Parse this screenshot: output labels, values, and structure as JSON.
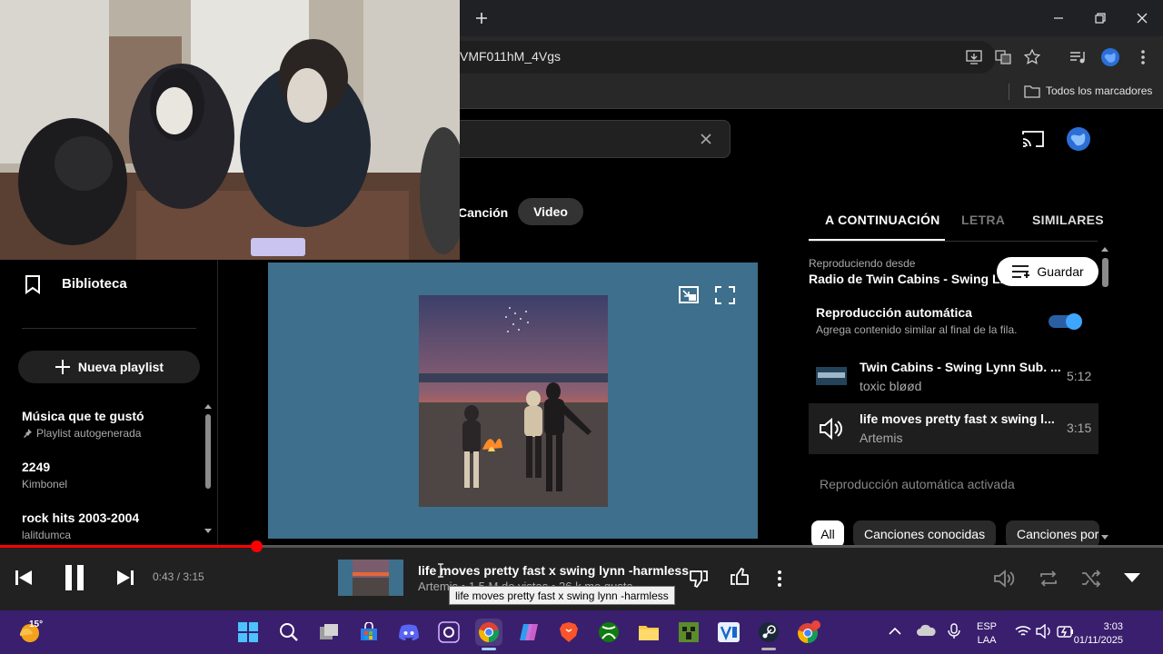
{
  "browser": {
    "url_fragment": "VMF011hM_4Vgs",
    "bookmarks_label": "Todos los marcadores"
  },
  "nav": {
    "library_label": "Biblioteca",
    "new_playlist_label": "Nueva playlist",
    "playlists": [
      {
        "title": "Música que te gustó",
        "subtitle": "Playlist autogenerada",
        "pinned": true
      },
      {
        "title": "2249",
        "subtitle": "Kimbonel"
      },
      {
        "title": "rock hits 2003-2004",
        "subtitle": "lalitdumca"
      }
    ]
  },
  "toggle": {
    "song_label": "Canción",
    "video_label": "Video",
    "active": "Video"
  },
  "queue_panel": {
    "tabs": [
      "A CONTINUACIÓN",
      "LETRA",
      "SIMILARES"
    ],
    "active_tab": "A CONTINUACIÓN",
    "playing_from_label": "Reproduciendo desde",
    "playing_from_title": "Radio de Twin Cabins - Swing L...",
    "save_label": "Guardar",
    "autoplay_title": "Reproducción automática",
    "autoplay_desc": "Agrega contenido similar al final de la fila.",
    "autoplay_on": true,
    "items": [
      {
        "title": "Twin Cabins - Swing Lynn Sub. ...",
        "artist": "toxic bløød",
        "duration": "5:12",
        "playing": false
      },
      {
        "title": "life moves pretty fast x swing l...",
        "artist": "Artemis",
        "duration": "3:15",
        "playing": true
      }
    ],
    "autoplay_status": "Reproducción automática activada",
    "chips": [
      "All",
      "Canciones conocidas",
      "Canciones por"
    ],
    "active_chip": "All"
  },
  "player": {
    "time": "0:43 / 3:15",
    "progress": 0.22,
    "title": "life moves pretty fast x swing lynn -harmless",
    "subtitle": "Artemis • 1,5 M de vistas • 26 k me gusta",
    "tooltip": "life moves pretty fast x swing lynn -harmless"
  },
  "taskbar": {
    "weather_temp": "15°",
    "lang_line1": "ESP",
    "lang_line2": "LAA",
    "time": "3:03",
    "date": "01/11/2025"
  },
  "colors": {
    "accent": "#ff0000",
    "toggle_blue": "#3ea6ff",
    "video_bg": "#3e6f8c",
    "taskbar": "#3a1f6e"
  }
}
